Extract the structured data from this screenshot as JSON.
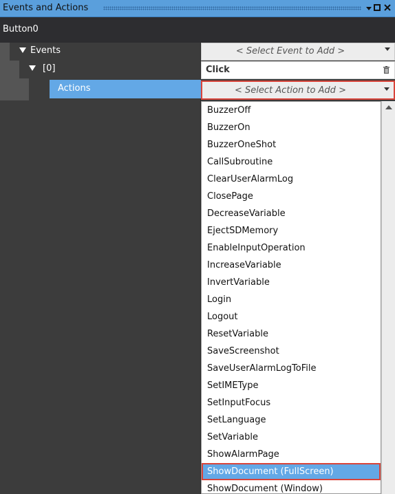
{
  "panel": {
    "title": "Events and Actions",
    "object_name": "Button0"
  },
  "tree": {
    "events_label": "Events",
    "index_label": "[0]",
    "actions_label": "Actions"
  },
  "right": {
    "select_event_placeholder": "< Select Event to Add >",
    "event_name": "Click",
    "select_action_placeholder": "< Select Action to Add >"
  },
  "actions_list": [
    "BuzzerOff",
    "BuzzerOn",
    "BuzzerOneShot",
    "CallSubroutine",
    "ClearUserAlarmLog",
    "ClosePage",
    "DecreaseVariable",
    "EjectSDMemory",
    "EnableInputOperation",
    "IncreaseVariable",
    "InvertVariable",
    "Login",
    "Logout",
    "ResetVariable",
    "SaveScreenshot",
    "SaveUserAlarmLogToFile",
    "SetIMEType",
    "SetInputFocus",
    "SetLanguage",
    "SetVariable",
    "ShowAlarmPage",
    "ShowDocument (FullScreen)",
    "ShowDocument (Window)"
  ],
  "highlighted_index": 21,
  "icons": {
    "dropdown": "chevron-down-icon",
    "maximize": "maximize-icon",
    "close": "close-icon",
    "delete": "trash-icon"
  },
  "colors": {
    "title_bar": "#5a9fdc",
    "selection": "#63a8e6",
    "highlight_border": "#d9443a",
    "dark_bg": "#3c3c3c"
  }
}
